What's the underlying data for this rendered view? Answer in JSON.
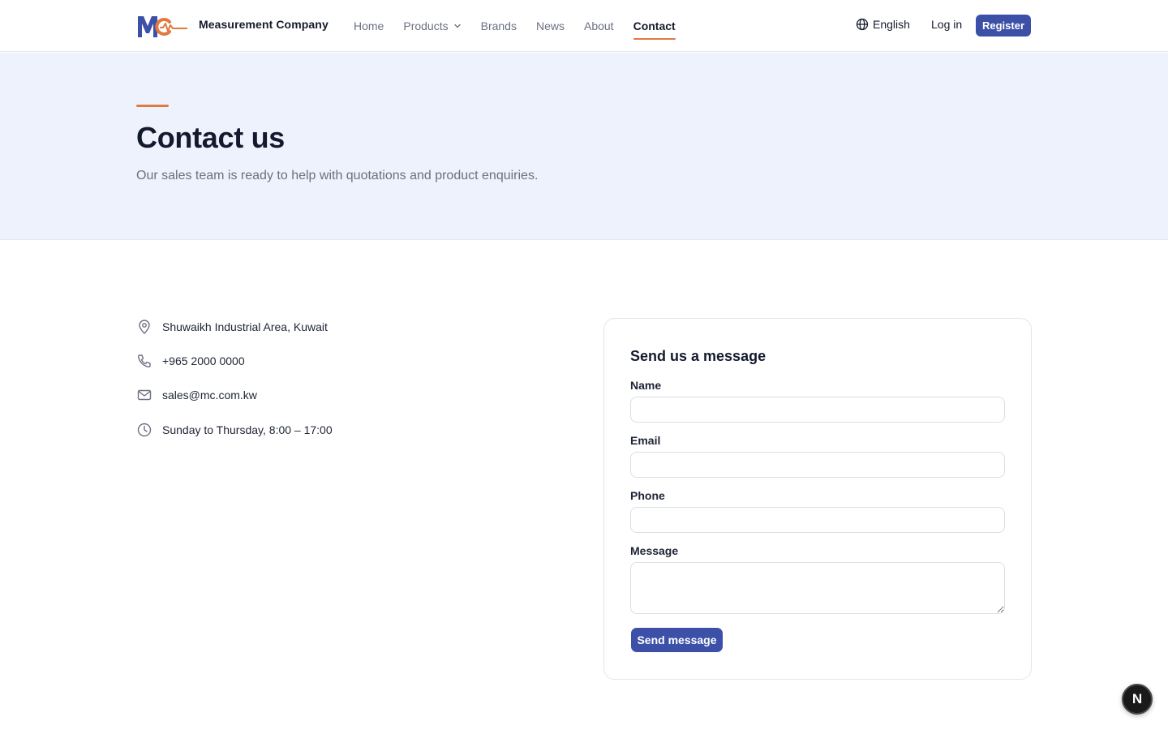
{
  "header": {
    "brand": "Measurement Company",
    "nav": [
      {
        "label": "Home"
      },
      {
        "label": "Products"
      },
      {
        "label": "Brands"
      },
      {
        "label": "News"
      },
      {
        "label": "About"
      },
      {
        "label": "Contact",
        "active": true
      }
    ],
    "language": "English",
    "login": "Log in",
    "register": "Register"
  },
  "hero": {
    "title": "Contact us",
    "subtitle": "Our sales team is ready to help with quotations and product enquiries."
  },
  "contact_info": {
    "address": "Shuwaikh Industrial Area, Kuwait",
    "phone": "+965 2000 0000",
    "email": "sales@mc.com.kw",
    "hours": "Sunday to Thursday, 8:00 – 17:00"
  },
  "form": {
    "title": "Send us a message",
    "name_label": "Name",
    "email_label": "Email",
    "phone_label": "Phone",
    "message_label": "Message",
    "name_value": "",
    "email_value": "",
    "phone_value": "",
    "message_value": "",
    "submit_label": "Send message"
  },
  "fab": {
    "label": "N"
  },
  "colors": {
    "primary": "#3c50a8",
    "accent": "#e07a3f",
    "hero_bg": "#eef2fc"
  },
  "icons": [
    "mc-logo",
    "chevron-down-icon",
    "globe-icon",
    "map-pin-icon",
    "phone-icon",
    "mail-icon",
    "clock-icon"
  ]
}
